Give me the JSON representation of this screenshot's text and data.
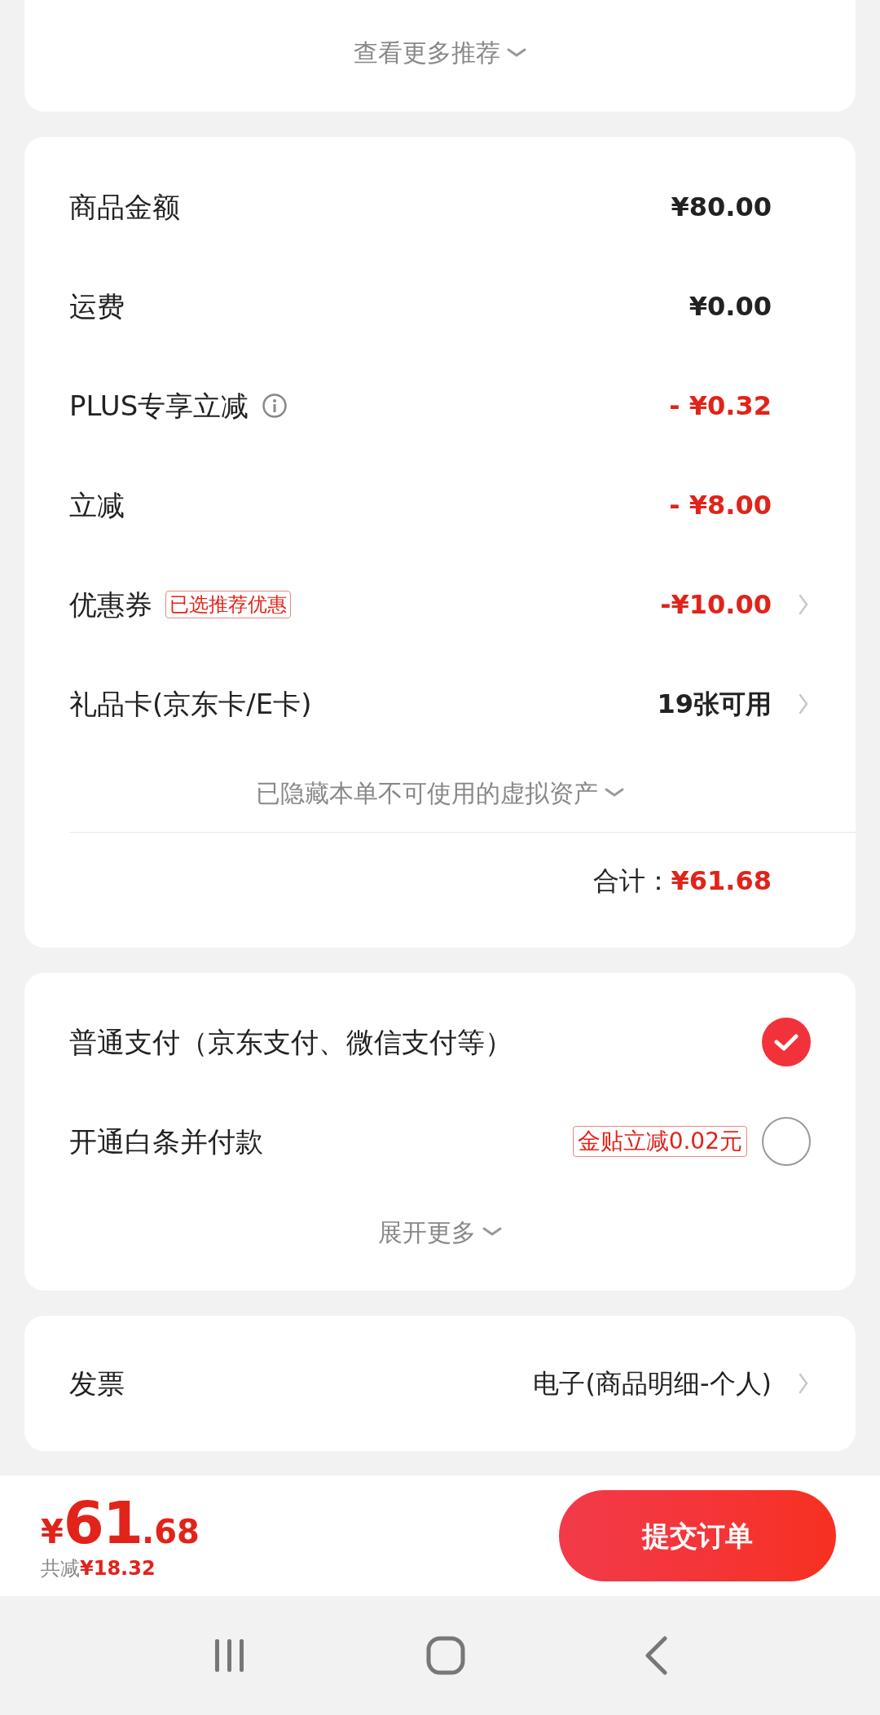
{
  "recommend_more": {
    "label": "查看更多推荐"
  },
  "summary": {
    "rows": [
      {
        "label": "商品金额",
        "info": false,
        "tag": null,
        "value": "¥80.00",
        "discount": false,
        "arrow": false
      },
      {
        "label": "运费",
        "info": false,
        "tag": null,
        "value": "¥0.00",
        "discount": false,
        "arrow": false
      },
      {
        "label": "PLUS专享立减",
        "info": true,
        "tag": null,
        "value": "- ¥0.32",
        "discount": true,
        "arrow": false
      },
      {
        "label": "立减",
        "info": false,
        "tag": null,
        "value": "- ¥8.00",
        "discount": true,
        "arrow": false
      },
      {
        "label": "优惠券",
        "info": false,
        "tag": "已选推荐优惠",
        "value": "-¥10.00",
        "discount": true,
        "arrow": true
      },
      {
        "label": "礼品卡(京东卡/E卡)",
        "info": false,
        "tag": null,
        "value": "19张可用",
        "discount": false,
        "arrow": true
      }
    ],
    "hidden_assets": "已隐藏本单不可使用的虚拟资产",
    "total_label": "合计：",
    "total_value": "¥61.68"
  },
  "payment": {
    "options": [
      {
        "label": "普通支付（京东支付、微信支付等）",
        "selected": true
      },
      {
        "label": "开通白条并付款",
        "tag": "金贴立减0.02元",
        "selected": false
      }
    ],
    "expand": "展开更多"
  },
  "invoice": {
    "label": "发票",
    "value": "电子(商品明细-个人)"
  },
  "footer": {
    "currency": "¥",
    "integer": "61",
    "decimal": ".68",
    "saved_label": "共减",
    "saved_value": "¥18.32",
    "submit": "提交订单"
  }
}
